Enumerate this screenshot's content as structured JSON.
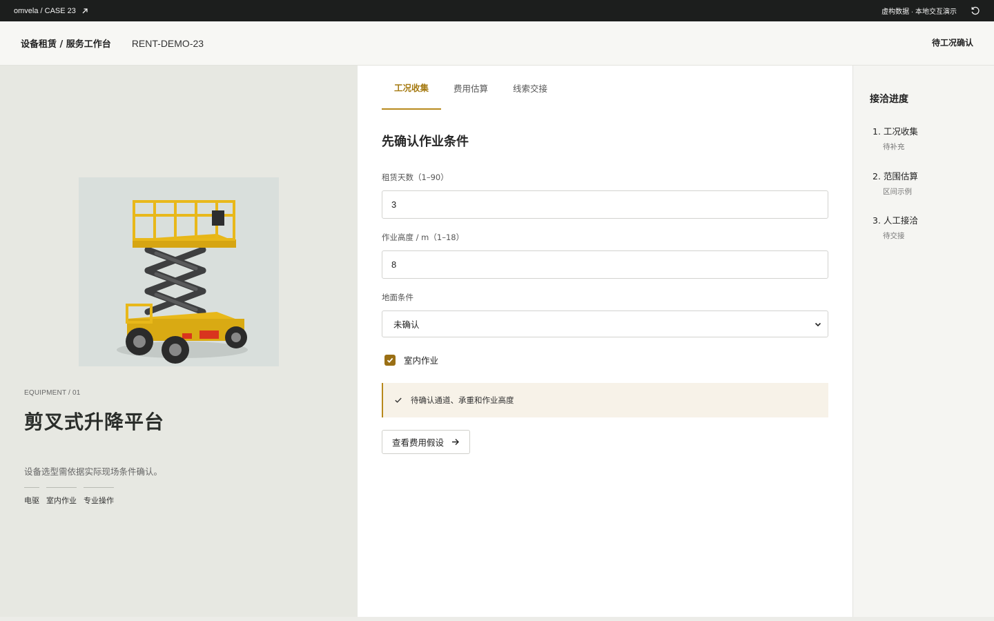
{
  "topbar": {
    "brand": "omvela / CASE 23",
    "notice": "虚构数据 · 本地交互演示"
  },
  "header": {
    "title": "设备租赁 / 服务工作台",
    "case_id": "RENT-DEMO-23",
    "status": "待工况确认"
  },
  "equipment": {
    "tag": "EQUIPMENT / 01",
    "name": "剪叉式升降平台",
    "description": "设备选型需依据实际现场条件确认。",
    "chips": [
      "电驱",
      "室内作业",
      "专业操作"
    ]
  },
  "tabs": [
    {
      "label": "工况收集",
      "active": true
    },
    {
      "label": "费用估算",
      "active": false
    },
    {
      "label": "线索交接",
      "active": false
    }
  ],
  "form": {
    "section_title": "先确认作业条件",
    "rental_days": {
      "label": "租赁天数（1–90）",
      "value": "3"
    },
    "height": {
      "label": "作业高度 / m（1–18）",
      "value": "8"
    },
    "ground": {
      "label": "地面条件",
      "selected": "未确认"
    },
    "indoor": {
      "label": "室内作业",
      "checked": true
    },
    "notice": "待确认通道、承重和作业高度",
    "button": "查看费用假设"
  },
  "progress": {
    "title": "接洽进度",
    "steps": [
      {
        "label": "1. 工况收集",
        "status": "待补充"
      },
      {
        "label": "2. 范围估算",
        "status": "区间示例"
      },
      {
        "label": "3. 人工接洽",
        "status": "待交接"
      }
    ]
  },
  "colors": {
    "accent": "#b8891c",
    "topbar": "#1c1e1d",
    "left_panel": "#e7e8e2",
    "notice_bg": "#f7f2e8"
  }
}
